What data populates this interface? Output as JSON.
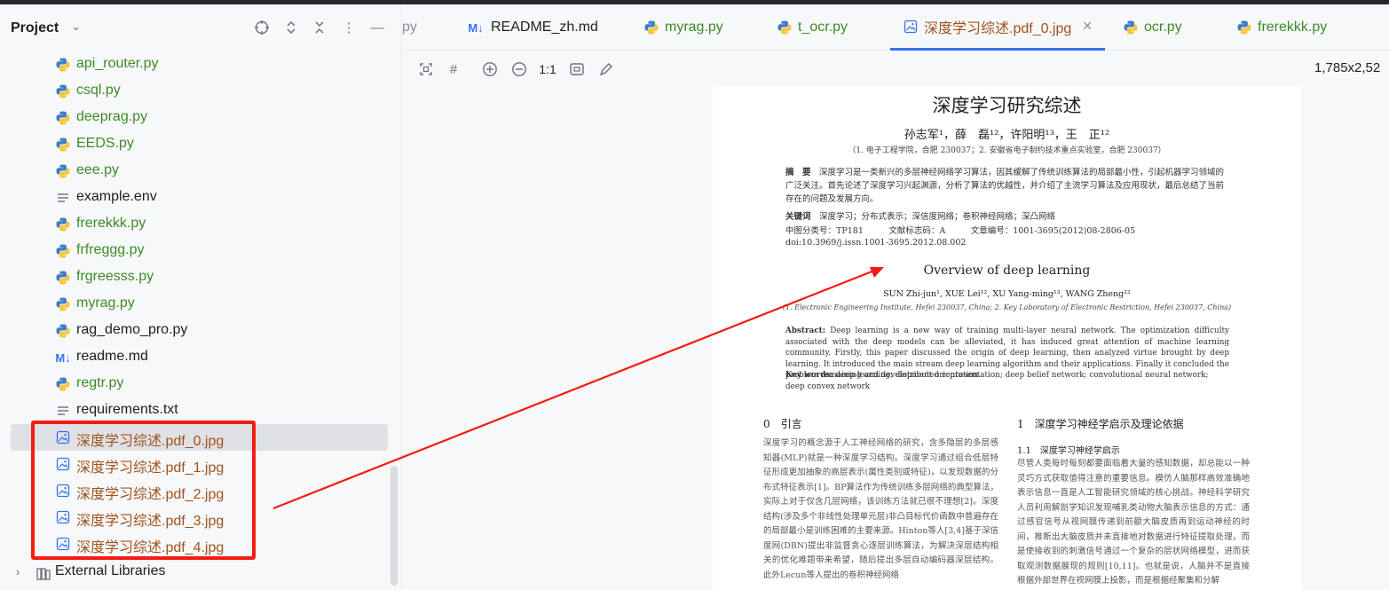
{
  "sidebar": {
    "title": "Project",
    "files": [
      {
        "name": "api_router.py",
        "type": "py"
      },
      {
        "name": "csql.py",
        "type": "py"
      },
      {
        "name": "deeprag.py",
        "type": "py"
      },
      {
        "name": "EEDS.py",
        "type": "py"
      },
      {
        "name": "eee.py",
        "type": "py"
      },
      {
        "name": "example.env",
        "type": "text"
      },
      {
        "name": "frerekkk.py",
        "type": "py"
      },
      {
        "name": "frfreggg.py",
        "type": "py"
      },
      {
        "name": "frgreesss.py",
        "type": "py"
      },
      {
        "name": "myrag.py",
        "type": "py"
      },
      {
        "name": "rag_demo_pro.py",
        "type": "py-plain"
      },
      {
        "name": "readme.md",
        "type": "md"
      },
      {
        "name": "regtr.py",
        "type": "py"
      },
      {
        "name": "requirements.txt",
        "type": "text"
      },
      {
        "name": "深度学习综述.pdf_0.jpg",
        "type": "img",
        "selected": true
      },
      {
        "name": "深度学习综述.pdf_1.jpg",
        "type": "img"
      },
      {
        "name": "深度学习综述.pdf_2.jpg",
        "type": "img"
      },
      {
        "name": "深度学习综述.pdf_3.jpg",
        "type": "img"
      },
      {
        "name": "深度学习综述.pdf_4.jpg",
        "type": "img"
      }
    ],
    "external_libraries": "External Libraries"
  },
  "tabs": [
    {
      "label": "py",
      "type": "partial"
    },
    {
      "label": "README_zh.md",
      "type": "md"
    },
    {
      "label": "myrag.py",
      "type": "py"
    },
    {
      "label": "t_ocr.py",
      "type": "py"
    },
    {
      "label": "深度学习综述.pdf_0.jpg",
      "type": "img",
      "active": true
    },
    {
      "label": "ocr.py",
      "type": "py"
    },
    {
      "label": "frerekkk.py",
      "type": "py"
    }
  ],
  "image_toolbar": {
    "actual_size_label": "1:1",
    "dimensions": "1,785x2,52"
  },
  "document": {
    "title": "深度学习研究综述",
    "authors": "孙志军¹，薛　磊¹²，许阳明¹³，王　正¹²",
    "affiliation": "（1. 电子工程学院，合肥 230037；2. 安徽省电子制约技术重点实验室，合肥 230037）",
    "abstract_label": "摘　要",
    "abstract": "深度学习是一类新兴的多层神经网络学习算法，因其缓解了传统训练算法的局部最小性，引起机器学习领域的广泛关注。首先论述了深度学习兴起渊源，分析了算法的优越性，并介绍了主流学习算法及应用现状，最后总结了当前存在的问题及发展方向。",
    "keywords_label": "关键词",
    "keywords": "深度学习；分布式表示；深信度网络；卷积神经网络；深凸网络",
    "classification": "中图分类号：TP181　　　文献标志码：A　　　文章编号：1001-3695(2012)08-2806-05",
    "doi": "doi:10.3969/j.issn.1001-3695.2012.08.002",
    "en_title": "Overview of deep learning",
    "en_authors": "SUN Zhi-jun¹, XUE Lei¹², XU Yang-ming¹³, WANG Zheng¹²",
    "en_affiliation": "(1. Electronic Engineering Institute, Hefei 230037, China; 2. Key Laboratory of Electronic Restriction, Hefei 230037, China)",
    "en_abstract_label": "Abstract:",
    "en_abstract": "Deep learning is a new way of training multi-layer neural network. The optimization difficulty associated with the deep models can be alleviated, it has induced great attention of machine learning community. Firstly, this paper discussed the origin of deep learning, then analyzed virtue brought by deep learning. It introduced the main stream deep learning algorithm and their applications. Finally it concluded the problem remaining and development orientation.",
    "en_keywords_label": "Key words:",
    "en_keywords": "deep learning; distributed representation; deep belief network; convolutional neural network; deep convex network",
    "section0": "0　引言",
    "section1": "1　深度学习神经学启示及理论依据",
    "section1_1": "1.1　深度学习神经学启示",
    "col_left": "深度学习的概念源于人工神经网络的研究，含多隐层的多层感知器(MLP)就是一种深度学习结构。深度学习通过组合低层特征形成更加抽象的高层表示(属性类别或特征)，以发现数据的分布式特征表示[1]。BP算法作为传统训练多层网络的典型算法，实际上对于仅含几层网络，该训练方法就已很不理想[2]。深度结构(涉及多个非线性处理单元层)非凸目标代价函数中普遍存在的局部最小是训练困难的主要来源。Hinton等人[3,4]基于深信度网(DBN)提出非监督贪心逐层训练算法，为解决深层结构相关的优化难题带来希望，随后提出多层自动编码器深层结构。此外Lecun等人提出的卷积神经网络",
    "col_right": "尽管人类每时每刻都要面临着大量的感知数据，却总能以一种灵巧方式获取值得注意的重要信息。模仿人脑那样高效准确地表示信息一直是人工智能研究领域的核心挑战。神经科学研究人员利用解剖学知识发现哺乳类动物大脑表示信息的方式：通过感官信号从视网膜传递到前额大脑皮质再到运动神经的时间，推断出大脑皮质并未直接地对数据进行特征提取处理，而是使接收到的刺激信号通过一个复杂的层状网络模型，进而获取观测数据展现的规则[10,11]。也就是说，人脑并不是直接根据外部世界在视网膜上投影，而是根据经聚集和分解"
  }
}
